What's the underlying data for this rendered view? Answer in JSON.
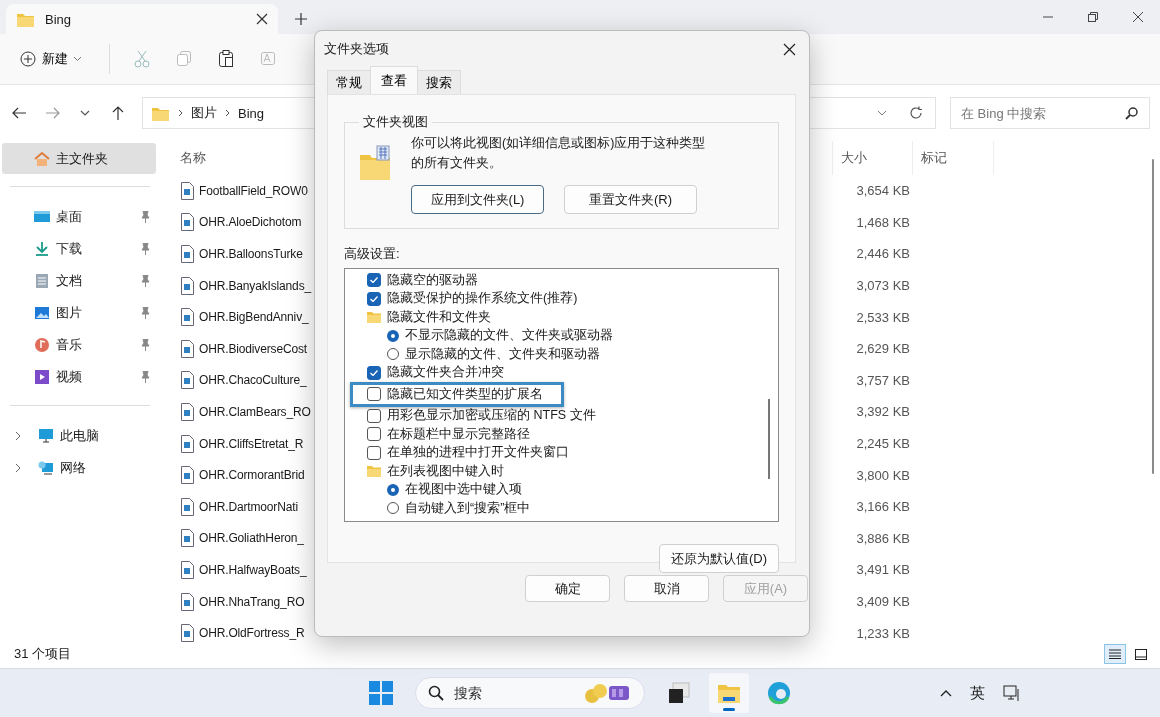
{
  "window": {
    "tab_title": "Bing"
  },
  "toolbar": {
    "new_label": "新建"
  },
  "address": {
    "path": [
      "图片",
      "Bing"
    ],
    "search_placeholder": "在 Bing 中搜索"
  },
  "sidebar": {
    "items": [
      {
        "label": "主文件夹",
        "kind": "home",
        "selected": true,
        "pinned": false
      },
      {
        "label": "桌面",
        "kind": "desktop",
        "selected": false,
        "pinned": true
      },
      {
        "label": "下载",
        "kind": "download",
        "selected": false,
        "pinned": true
      },
      {
        "label": "文档",
        "kind": "document",
        "selected": false,
        "pinned": true
      },
      {
        "label": "图片",
        "kind": "picture",
        "selected": false,
        "pinned": true
      },
      {
        "label": "音乐",
        "kind": "music",
        "selected": false,
        "pinned": true
      },
      {
        "label": "视频",
        "kind": "video",
        "selected": false,
        "pinned": true
      },
      {
        "label": "此电脑",
        "kind": "pc",
        "selected": false,
        "pinned": false,
        "expanded": false
      },
      {
        "label": "网络",
        "kind": "network",
        "selected": false,
        "pinned": false,
        "expanded": false
      }
    ]
  },
  "table": {
    "columns": [
      "名称",
      "大小",
      "标记"
    ],
    "rows": [
      {
        "name": "FootballField_ROW0",
        "size": "3,654 KB"
      },
      {
        "name": "OHR.AloeDichotom",
        "size": "1,468 KB"
      },
      {
        "name": "OHR.BalloonsTurke",
        "size": "2,446 KB"
      },
      {
        "name": "OHR.BanyakIslands_",
        "size": "3,073 KB"
      },
      {
        "name": "OHR.BigBendAnniv_",
        "size": "2,533 KB"
      },
      {
        "name": "OHR.BiodiverseCost",
        "size": "2,629 KB"
      },
      {
        "name": "OHR.ChacoCulture_",
        "size": "3,757 KB"
      },
      {
        "name": "OHR.ClamBears_RO",
        "size": "3,392 KB"
      },
      {
        "name": "OHR.CliffsEtretat_R",
        "size": "2,245 KB"
      },
      {
        "name": "OHR.CormorantBrid",
        "size": "3,800 KB"
      },
      {
        "name": "OHR.DartmoorNati",
        "size": "3,166 KB"
      },
      {
        "name": "OHR.GoliathHeron_",
        "size": "3,886 KB"
      },
      {
        "name": "OHR.HalfwayBoats_",
        "size": "3,491 KB"
      },
      {
        "name": "OHR.NhaTrang_RO",
        "size": "3,409 KB"
      },
      {
        "name": "OHR.OldFortress_R",
        "size": "1,233 KB"
      }
    ]
  },
  "status_bar": {
    "count": "31 个项目"
  },
  "dialog": {
    "title": "文件夹选项",
    "tabs": [
      {
        "label": "常规",
        "selected": false
      },
      {
        "label": "查看",
        "selected": true
      },
      {
        "label": "搜索",
        "selected": false
      }
    ],
    "folder_views": {
      "legend": "文件夹视图",
      "description": "你可以将此视图(如详细信息或图标)应用于这种类型的所有文件夹。",
      "buttons": [
        {
          "label": "应用到文件夹(L)",
          "default": true
        },
        {
          "label": "重置文件夹(R)",
          "default": false
        }
      ]
    },
    "advanced_label": "高级设置:",
    "settings": [
      {
        "kind": "checkbox",
        "label": "隐藏空的驱动器",
        "checked": true,
        "highlighted": false
      },
      {
        "kind": "checkbox",
        "label": "隐藏受保护的操作系统文件(推荐)",
        "checked": true,
        "highlighted": false
      },
      {
        "kind": "folder",
        "label": "隐藏文件和文件夹",
        "children": [
          {
            "kind": "radio",
            "label": "不显示隐藏的文件、文件夹或驱动器",
            "checked": true
          },
          {
            "kind": "radio",
            "label": "显示隐藏的文件、文件夹和驱动器",
            "checked": false
          }
        ]
      },
      {
        "kind": "checkbox",
        "label": "隐藏文件夹合并冲突",
        "checked": true,
        "highlighted": false
      },
      {
        "kind": "checkbox",
        "label": "隐藏已知文件类型的扩展名",
        "checked": false,
        "highlighted": true
      },
      {
        "kind": "checkbox",
        "label": "用彩色显示加密或压缩的 NTFS 文件",
        "checked": false,
        "highlighted": false
      },
      {
        "kind": "checkbox",
        "label": "在标题栏中显示完整路径",
        "checked": false,
        "highlighted": false
      },
      {
        "kind": "checkbox",
        "label": "在单独的进程中打开文件夹窗口",
        "checked": false,
        "highlighted": false
      },
      {
        "kind": "folder",
        "label": "在列表视图中键入时",
        "children": [
          {
            "kind": "radio",
            "label": "在视图中选中键入项",
            "checked": true
          },
          {
            "kind": "radio",
            "label": "自动键入到“搜索”框中",
            "checked": false
          }
        ]
      }
    ],
    "restore_button": "还原为默认值(D)",
    "footer_buttons": [
      {
        "label": "确定",
        "disabled": false
      },
      {
        "label": "取消",
        "disabled": false
      },
      {
        "label": "应用(A)",
        "disabled": true
      }
    ]
  },
  "taskbar": {
    "search_placeholder": "搜索",
    "apps": [
      {
        "kind": "taskview",
        "active": false
      },
      {
        "kind": "explorer",
        "active": true
      },
      {
        "kind": "edge",
        "active": false
      }
    ],
    "ime": "英"
  }
}
